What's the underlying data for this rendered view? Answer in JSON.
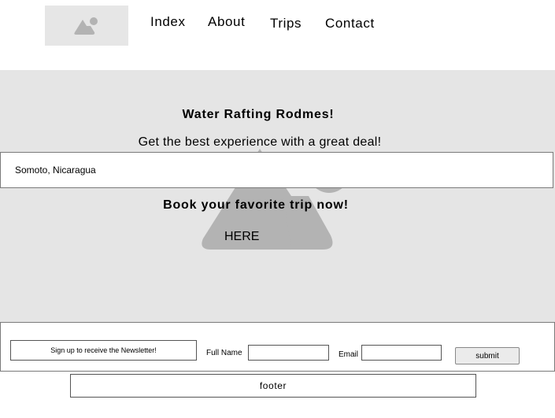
{
  "header": {
    "logo_icon": "image-placeholder-icon",
    "nav": [
      {
        "label": "Index"
      },
      {
        "label": "About"
      },
      {
        "label": "Trips"
      },
      {
        "label": "Contact"
      }
    ]
  },
  "hero": {
    "background_icon": "image-placeholder-icon",
    "title": "Water Rafting Rodmes!",
    "subtitle": "Get the best experience with a great deal!",
    "location": "Somoto, Nicaragua",
    "cta_heading": "Book your favorite trip now!",
    "cta_link": "HERE"
  },
  "newsletter": {
    "label": "Sign up to receive the Newsletter!",
    "full_name_label": "Full Name",
    "full_name_value": "",
    "email_label": "Email",
    "email_value": "",
    "submit_label": "submit"
  },
  "footer": {
    "text": "footer"
  },
  "colors": {
    "placeholder_bg": "#e6e6e6",
    "placeholder_icon": "#b3b3b3",
    "border": "#7a7a7a"
  }
}
